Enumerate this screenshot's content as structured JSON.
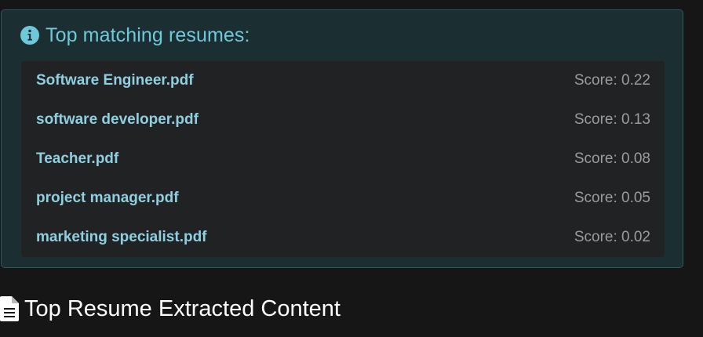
{
  "alert": {
    "icon": "info-circle-icon",
    "title": "Top matching resumes:"
  },
  "results": [
    {
      "file": "Software Engineer.pdf",
      "score": "Score: 0.22"
    },
    {
      "file": "software developer.pdf",
      "score": "Score: 0.13"
    },
    {
      "file": "Teacher.pdf",
      "score": "Score: 0.08"
    },
    {
      "file": "project manager.pdf",
      "score": "Score: 0.05"
    },
    {
      "file": "marketing specialist.pdf",
      "score": "Score: 0.02"
    }
  ],
  "section": {
    "icon": "file-text-icon",
    "title": "Top Resume Extracted Content"
  },
  "colors": {
    "accent": "#6fc8d9",
    "alert_background": "#1b2f33",
    "list_background": "#212224"
  }
}
